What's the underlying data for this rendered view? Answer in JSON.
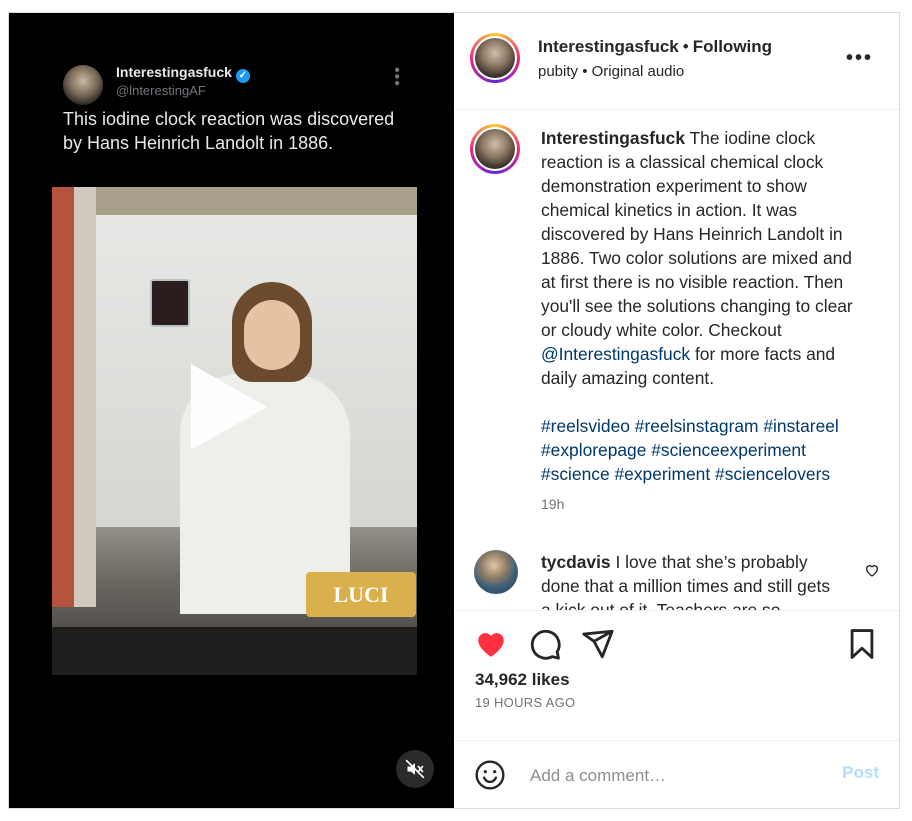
{
  "media": {
    "tweet": {
      "name": "Interestingasfuck",
      "handle": "@lnterestingAF",
      "text": "This iodine clock reaction was discovered by Hans Heinrich Landolt in 1886."
    },
    "sign_text": "LUCI",
    "play_icon": "play-icon",
    "mute_icon": "muted-speaker-icon"
  },
  "header": {
    "username": "Interestingasfuck",
    "separator": "•",
    "follow_state": "Following",
    "subline_user": "pubity",
    "subline_sep": "•",
    "subline_audio": "Original audio",
    "more_label": "•••"
  },
  "caption": {
    "username": "Interestingasfuck",
    "text_before_link": "The iodine clock reaction is a classical chemical clock demonstration experiment to show chemical kinetics in action. It was discovered by Hans Heinrich Landolt in 1886. Two color solutions are mixed and at first there is no visible reaction. Then you'll see the solutions changing to clear or cloudy white color. Checkout ",
    "mention": "@Interestingasfuck",
    "text_after_link": " for more facts and daily amazing content.",
    "hashtags": [
      "#reelsvideo",
      "#reelsinstagram",
      "#instareel",
      "#explorepage",
      "#scienceexperiment",
      "#science",
      "#experiment",
      "#sciencelovers"
    ],
    "time": "19h"
  },
  "comment": {
    "username": "tycdavis",
    "text": "I love that she’s probably done that a million times and still gets a kick out of it. Teachers are so"
  },
  "actions": {
    "likes": "34,962 likes",
    "ago": "19 HOURS AGO",
    "like_color": "#ff3040"
  },
  "add_comment": {
    "placeholder": "Add a comment…",
    "post_label": "Post"
  }
}
